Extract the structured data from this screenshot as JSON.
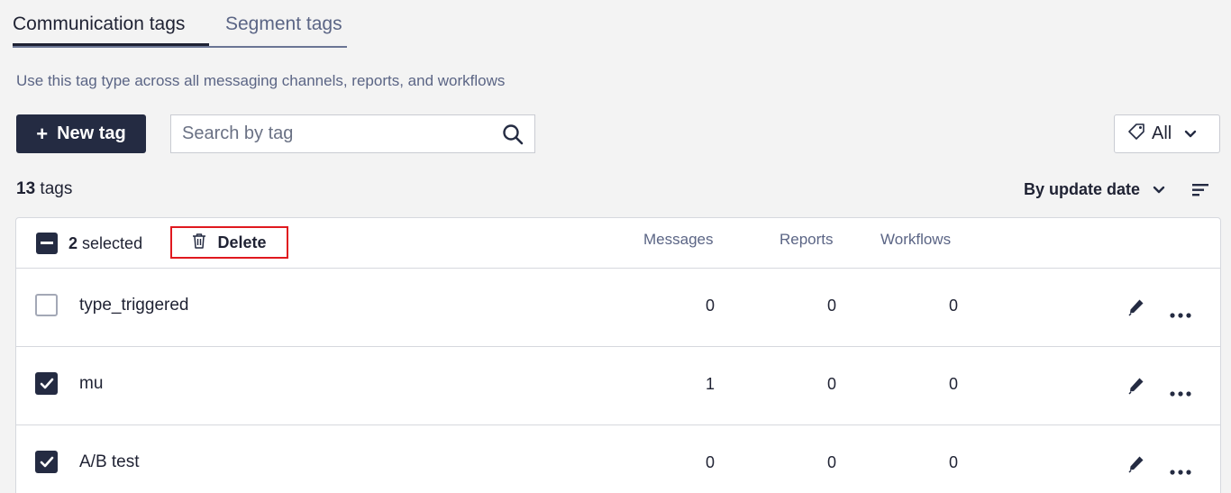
{
  "tabs": [
    {
      "label": "Communication tags",
      "active": true
    },
    {
      "label": "Segment tags",
      "active": false
    }
  ],
  "description": "Use this tag type across all messaging channels, reports, and workflows",
  "toolbar": {
    "new_tag_label": "New tag",
    "search_placeholder": "Search by tag",
    "filter_label": "All"
  },
  "summary": {
    "count": "13",
    "count_unit": "tags",
    "sort_label": "By update date"
  },
  "table": {
    "selected_count": "2",
    "selected_label": "selected",
    "delete_label": "Delete",
    "columns": [
      "Messages",
      "Reports",
      "Workflows"
    ],
    "rows": [
      {
        "name": "type_triggered",
        "checked": false,
        "messages": "0",
        "reports": "0",
        "workflows": "0"
      },
      {
        "name": "mu",
        "checked": true,
        "messages": "1",
        "reports": "0",
        "workflows": "0"
      },
      {
        "name": "A/B test",
        "checked": true,
        "messages": "0",
        "reports": "0",
        "workflows": "0"
      }
    ]
  },
  "colors": {
    "primary": "#242b42",
    "highlight": "#e0191f",
    "muted_text": "#5b6585"
  }
}
